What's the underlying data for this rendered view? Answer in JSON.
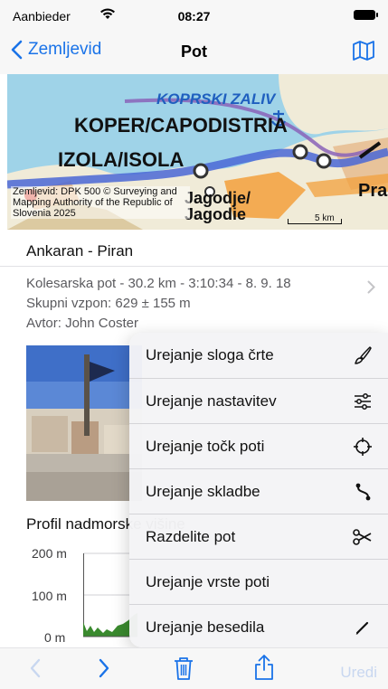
{
  "status_bar": {
    "carrier": "Aanbieder",
    "time": "08:27"
  },
  "nav": {
    "back_label": "Zemljevid",
    "title": "Pot",
    "map_icon": "map-icon"
  },
  "map": {
    "bay_label": "KOPRSKI ZALIV",
    "city_koper": "KOPER/CAPODISTRIA",
    "city_izola": "IZOLA/ISOLA",
    "city_jagodje": "Jagodje/ Jagodie",
    "city_partial": "Pra",
    "attribution": "Zemljevid: DPK 500 © Surveying and Mapping Authority of the Republic of Slovenia 2025",
    "scale": "5 km"
  },
  "track": {
    "name": "Ankaran - Piran",
    "summary": "Kolesarska pot - 30.2 km - 3:10:34 - 8. 9. 18",
    "ascent": "Skupni vzpon: 629 ± 155 m",
    "author": "Avtor: John Coster"
  },
  "profile": {
    "title": "Profil nadmorske višine",
    "axis_200": "200 m",
    "axis_100": "100 m",
    "axis_0": "0 m"
  },
  "menu": {
    "items": [
      {
        "label": "Urejanje sloga črte",
        "icon": "brush-icon"
      },
      {
        "label": "Urejanje nastavitev",
        "icon": "sliders-icon"
      },
      {
        "label": "Urejanje točk poti",
        "icon": "crosshair-icon"
      },
      {
        "label": "Urejanje skladbe",
        "icon": "path-icon"
      },
      {
        "label": "Razdelite pot",
        "icon": "scissors-icon"
      },
      {
        "label": "Urejanje vrste poti",
        "icon": ""
      },
      {
        "label": "Urejanje besedila",
        "icon": "pencil-icon"
      }
    ]
  },
  "toolbar": {
    "edit_label": "Uredi",
    "icons": [
      "chevron-left-icon",
      "chevron-right-icon",
      "trash-icon",
      "share-icon"
    ]
  },
  "colors": {
    "accent": "#1a73e8",
    "disabled": "#c8d7f0",
    "sea": "#9fd3e8",
    "route": "#4a67d6"
  }
}
